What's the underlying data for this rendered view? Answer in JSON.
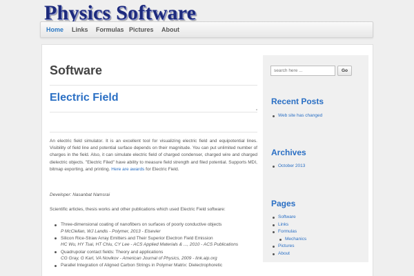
{
  "site": {
    "title": "Physics Software"
  },
  "nav": [
    {
      "label": "Home",
      "active": true
    },
    {
      "label": "Links",
      "active": false
    },
    {
      "label": "Formulas",
      "active": false
    },
    {
      "label": "Pictures",
      "active": false
    },
    {
      "label": "About",
      "active": false
    }
  ],
  "main": {
    "page_title": "Software",
    "post_title": "Electric Field",
    "intro": "An electric field simulator. It is an excellent tool for visualizing electric field and equipotential lines. Visibility of field line and potential surface depends on their magnitude. You can put unlimited number of charges in the field. Also, it can simulate electric field of charged condenser, charged wire and charged dielectric objects. \"Electric Filed\" have ability to measure field strength and filed potential. Supports MDI, bitmap exporting, and printing.",
    "awards_link": "Here are awards",
    "awards_tail": "for Electric Field.",
    "developer": "Developer: Nasanbat Namsrai",
    "sci_intro": "Scientific articles, thesis works and other publications which used Electric Field software:",
    "publications": [
      {
        "title": "Three-dimensional coating of nanofibers on surfaces of poorly conductive objects",
        "authors": "P McClellan, WJ Landis - Polymer, 2013 - Elsevier"
      },
      {
        "title": "Silicon Rice-Straw Array Emitters and Their Superior Electron Field Emission",
        "authors": "HC Wu, HY Tsai, HT Chiu, CY Lee - ACS Applied Materials & ..., 2010 - ACS Publications"
      },
      {
        "title": "Quadrupolar contact fields: Theory and applications",
        "authors": "CG Gray, G Karl, VA Novikov - American Journal of Physics, 2009 - link.aip.org"
      },
      {
        "title": "Parallel Integration of Aligned Carbon Strings in Polymer Matrix: Dielectrophoretic",
        "authors": ""
      }
    ]
  },
  "sidebar": {
    "search": {
      "placeholder": "search here ...",
      "button": "Go"
    },
    "recent_posts": {
      "title": "Recent Posts",
      "items": [
        "Web site has changed"
      ]
    },
    "archives": {
      "title": "Archives",
      "items": [
        "October 2013"
      ]
    },
    "pages": {
      "title": "Pages",
      "items": [
        {
          "label": "Software",
          "sub": false
        },
        {
          "label": "Links",
          "sub": false
        },
        {
          "label": "Formulas",
          "sub": false
        },
        {
          "label": "Mechanics",
          "sub": true
        },
        {
          "label": "Pictures",
          "sub": false
        },
        {
          "label": "About",
          "sub": false
        }
      ]
    }
  },
  "colors": {
    "accent": "#2a6fc4",
    "logo": "#1d2a7c",
    "background": "#efefef"
  }
}
